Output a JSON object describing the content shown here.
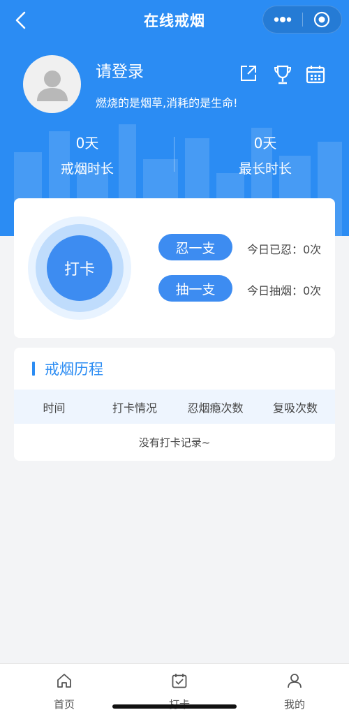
{
  "nav": {
    "title": "在线戒烟",
    "back_icon": "chevron-left-icon",
    "more_icon": "more-dots-icon",
    "close_icon": "target-circle-icon"
  },
  "profile": {
    "login_label": "请登录",
    "motto": "燃烧的是烟草,消耗的是生命!",
    "avatar_icon": "user-avatar-icon",
    "actions": [
      "share-icon",
      "trophy-icon",
      "calendar-icon"
    ]
  },
  "stats": [
    {
      "value": "0天",
      "label": "戒烟时长"
    },
    {
      "value": "0天",
      "label": "最长时长"
    }
  ],
  "checkin": {
    "button_label": "打卡",
    "actions": [
      {
        "label": "忍一支",
        "count_text": "今日已忍：0次"
      },
      {
        "label": "抽一支",
        "count_text": "今日抽烟：0次"
      }
    ]
  },
  "history": {
    "title": "戒烟历程",
    "columns": [
      "时间",
      "打卡情况",
      "忍烟瘾次数",
      "复吸次数"
    ],
    "empty_text": "没有打卡记录~"
  },
  "tabbar": {
    "items": [
      {
        "label": "首页",
        "icon": "home-icon"
      },
      {
        "label": "打卡",
        "icon": "calendar-check-icon"
      },
      {
        "label": "我的",
        "icon": "user-icon"
      }
    ]
  },
  "colors": {
    "primary": "#2b8cf3",
    "button": "#3d8cf1",
    "page_bg": "#f3f4f6"
  }
}
